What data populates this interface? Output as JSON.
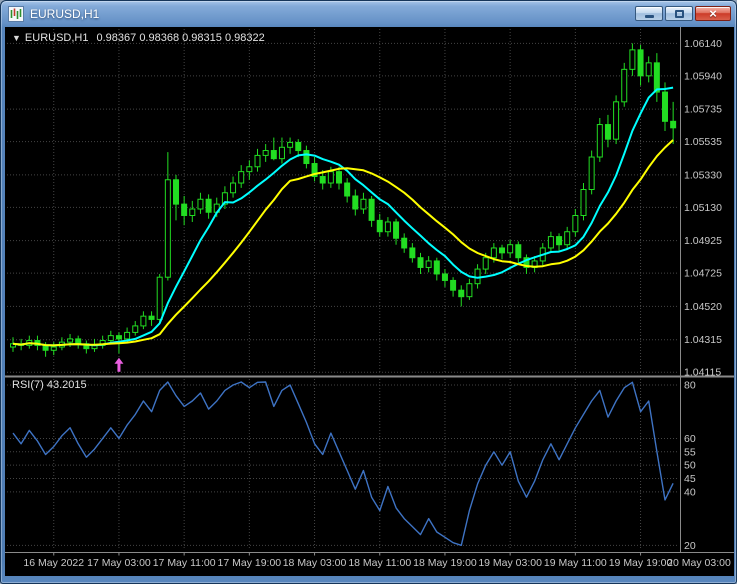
{
  "window": {
    "title": "EURUSD,H1",
    "close_glyph": "×"
  },
  "chart": {
    "collapse_glyph": "▼",
    "symbol": "EURUSD,H1",
    "ohlc": "0.98367 0.98368 0.98315 0.98322"
  },
  "chart_data": {
    "type": "candlestick",
    "symbol": "EURUSD",
    "timeframe": "H1",
    "colors": {
      "background": "#000000",
      "grid": "#454545",
      "axis_text": "#c8c8c8",
      "candle": "#22dd22",
      "ma_fast": "#00ffff",
      "ma_slow": "#ffff00",
      "rsi_line": "#3e73c4",
      "separator": "#8a8a8a",
      "marker": "#ea5fe0"
    },
    "price_axis": {
      "labels": [
        "1.06140",
        "1.05940",
        "1.05735",
        "1.05535",
        "1.05330",
        "1.05130",
        "1.04925",
        "1.04725",
        "1.04520",
        "1.04315",
        "1.04115"
      ],
      "top_value": 1.0621,
      "bottom_value": 1.0411
    },
    "time_axis": {
      "labels": [
        "16 May 2022",
        "17 May 03:00",
        "17 May 11:00",
        "17 May 19:00",
        "18 May 03:00",
        "18 May 11:00",
        "18 May 19:00",
        "19 May 03:00",
        "19 May 11:00",
        "19 May 19:00",
        "20 May 03:00"
      ],
      "tick_indices": [
        5,
        13,
        21,
        29,
        37,
        45,
        53,
        61,
        69,
        77,
        85
      ]
    },
    "candles": [
      [
        1.0427,
        1.0433,
        1.0424,
        1.0429
      ],
      [
        1.0429,
        1.0432,
        1.0425,
        1.0428
      ],
      [
        1.0428,
        1.0434,
        1.0426,
        1.0431
      ],
      [
        1.0431,
        1.0434,
        1.0425,
        1.0428
      ],
      [
        1.0428,
        1.043,
        1.0421,
        1.0425
      ],
      [
        1.0425,
        1.043,
        1.0422,
        1.0427
      ],
      [
        1.0427,
        1.0433,
        1.0425,
        1.043
      ],
      [
        1.043,
        1.0435,
        1.0427,
        1.0432
      ],
      [
        1.0432,
        1.0434,
        1.0426,
        1.0429
      ],
      [
        1.0429,
        1.0431,
        1.0423,
        1.0426
      ],
      [
        1.0426,
        1.0432,
        1.0424,
        1.0428
      ],
      [
        1.0428,
        1.0434,
        1.0426,
        1.0431
      ],
      [
        1.0431,
        1.0437,
        1.0429,
        1.0434
      ],
      [
        1.0434,
        1.0436,
        1.0423,
        1.0432
      ],
      [
        1.0432,
        1.0439,
        1.043,
        1.0436
      ],
      [
        1.0436,
        1.0443,
        1.0434,
        1.044
      ],
      [
        1.044,
        1.0449,
        1.0438,
        1.0446
      ],
      [
        1.0446,
        1.0449,
        1.044,
        1.0444
      ],
      [
        1.0444,
        1.0472,
        1.0442,
        1.047
      ],
      [
        1.047,
        1.0547,
        1.0468,
        1.053
      ],
      [
        1.053,
        1.0533,
        1.0505,
        1.0515
      ],
      [
        1.0515,
        1.052,
        1.0502,
        1.0508
      ],
      [
        1.0508,
        1.0517,
        1.0504,
        1.0512
      ],
      [
        1.0512,
        1.0522,
        1.0509,
        1.0518
      ],
      [
        1.0518,
        1.0521,
        1.0506,
        1.051
      ],
      [
        1.051,
        1.0519,
        1.0507,
        1.0515
      ],
      [
        1.0515,
        1.0526,
        1.0512,
        1.0522
      ],
      [
        1.0522,
        1.0532,
        1.0519,
        1.0528
      ],
      [
        1.0528,
        1.0539,
        1.0525,
        1.0535
      ],
      [
        1.0535,
        1.0542,
        1.053,
        1.0538
      ],
      [
        1.0538,
        1.0549,
        1.0535,
        1.0545
      ],
      [
        1.0545,
        1.0552,
        1.0541,
        1.0548
      ],
      [
        1.0548,
        1.0556,
        1.0542,
        1.0543
      ],
      [
        1.0543,
        1.0556,
        1.054,
        1.055
      ],
      [
        1.055,
        1.0556,
        1.0546,
        1.0553
      ],
      [
        1.0553,
        1.0555,
        1.0544,
        1.0548
      ],
      [
        1.0548,
        1.0551,
        1.0537,
        1.054
      ],
      [
        1.054,
        1.0544,
        1.0529,
        1.0532
      ],
      [
        1.0532,
        1.0536,
        1.0524,
        1.0528
      ],
      [
        1.0528,
        1.0538,
        1.0525,
        1.0535
      ],
      [
        1.0535,
        1.0538,
        1.0524,
        1.0528
      ],
      [
        1.0528,
        1.0531,
        1.0516,
        1.052
      ],
      [
        1.052,
        1.0524,
        1.0508,
        1.0512
      ],
      [
        1.0512,
        1.0522,
        1.0509,
        1.0518
      ],
      [
        1.0518,
        1.052,
        1.0501,
        1.0505
      ],
      [
        1.0505,
        1.0509,
        1.0495,
        1.0498
      ],
      [
        1.0498,
        1.0507,
        1.0495,
        1.0504
      ],
      [
        1.0504,
        1.0506,
        1.049,
        1.0494
      ],
      [
        1.0494,
        1.0497,
        1.0485,
        1.0488
      ],
      [
        1.0488,
        1.0491,
        1.0479,
        1.0482
      ],
      [
        1.0482,
        1.0485,
        1.0472,
        1.0476
      ],
      [
        1.0476,
        1.0483,
        1.0473,
        1.048
      ],
      [
        1.048,
        1.0482,
        1.0468,
        1.0472
      ],
      [
        1.0472,
        1.0475,
        1.0464,
        1.0468
      ],
      [
        1.0468,
        1.047,
        1.0458,
        1.0462
      ],
      [
        1.0462,
        1.0465,
        1.0452,
        1.0458
      ],
      [
        1.0458,
        1.0469,
        1.0456,
        1.0466
      ],
      [
        1.0466,
        1.0478,
        1.0463,
        1.0475
      ],
      [
        1.0475,
        1.0485,
        1.0472,
        1.0482
      ],
      [
        1.0482,
        1.0491,
        1.0479,
        1.0488
      ],
      [
        1.0488,
        1.049,
        1.0481,
        1.0485
      ],
      [
        1.0485,
        1.0493,
        1.0482,
        1.049
      ],
      [
        1.049,
        1.0492,
        1.0478,
        1.0482
      ],
      [
        1.0482,
        1.0484,
        1.0472,
        1.0476
      ],
      [
        1.0476,
        1.0483,
        1.0473,
        1.048
      ],
      [
        1.048,
        1.0491,
        1.0477,
        1.0488
      ],
      [
        1.0488,
        1.0498,
        1.0485,
        1.0495
      ],
      [
        1.0495,
        1.0497,
        1.0486,
        1.049
      ],
      [
        1.049,
        1.0501,
        1.0487,
        1.0498
      ],
      [
        1.0498,
        1.0512,
        1.0495,
        1.0508
      ],
      [
        1.0508,
        1.0528,
        1.0505,
        1.0524
      ],
      [
        1.0524,
        1.0548,
        1.0521,
        1.0544
      ],
      [
        1.0544,
        1.0568,
        1.0541,
        1.0564
      ],
      [
        1.0564,
        1.057,
        1.055,
        1.0555
      ],
      [
        1.0555,
        1.0582,
        1.0552,
        1.0578
      ],
      [
        1.0578,
        1.0602,
        1.0575,
        1.0598
      ],
      [
        1.0598,
        1.0614,
        1.0594,
        1.061
      ],
      [
        1.061,
        1.0613,
        1.0588,
        1.0594
      ],
      [
        1.0594,
        1.0606,
        1.059,
        1.0602
      ],
      [
        1.0602,
        1.0608,
        1.0578,
        1.0584
      ],
      [
        1.0584,
        1.059,
        1.056,
        1.0566
      ],
      [
        1.0566,
        1.0578,
        1.0552,
        1.0562
      ]
    ],
    "overlays": [
      {
        "name": "ma-fast-line",
        "type": "sma",
        "period": 8,
        "color_key": "ma_fast"
      },
      {
        "name": "ma-slow-line",
        "type": "sma",
        "period": 16,
        "color_key": "ma_slow"
      }
    ],
    "marker": {
      "type": "up-arrow",
      "index": 13,
      "price": 1.0421
    },
    "rsi": {
      "label": "RSI(7) 43.2015",
      "period": 7,
      "value": 43.2015,
      "levels": [
        80,
        60,
        55,
        50,
        45,
        40,
        20
      ],
      "top_value": 81.5,
      "bottom_value": 19.0,
      "values": [
        62,
        58,
        63,
        59,
        54,
        57,
        61,
        64,
        58,
        53,
        56,
        60,
        64,
        60,
        65,
        69,
        74,
        70,
        78,
        82,
        76,
        72,
        74,
        77,
        71,
        74,
        78,
        80,
        82,
        79,
        81,
        82,
        72,
        78,
        80,
        73,
        66,
        58,
        54,
        62,
        55,
        48,
        41,
        48,
        38,
        33,
        42,
        34,
        30,
        27,
        24,
        30,
        25,
        23,
        21,
        20,
        33,
        43,
        50,
        55,
        50,
        55,
        44,
        38,
        44,
        52,
        58,
        52,
        58,
        64,
        69,
        74,
        78,
        68,
        74,
        79,
        81,
        70,
        74,
        55,
        37,
        43.2
      ]
    }
  }
}
